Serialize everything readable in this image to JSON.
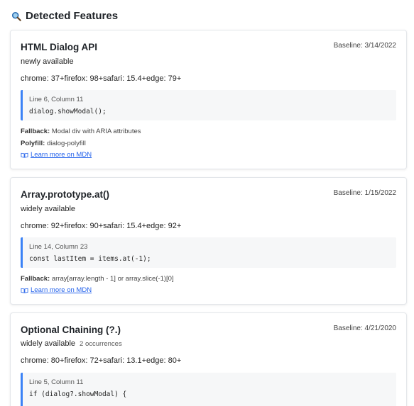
{
  "header": {
    "title": "Detected Features"
  },
  "features": [
    {
      "name": "HTML Dialog API",
      "baseline": "Baseline: 3/14/2022",
      "status": "newly available",
      "occurrences": "",
      "support": "chrome: 37+firefox: 98+safari: 15.4+edge: 79+",
      "location": "Line 6, Column 11",
      "code": "dialog.showModal();",
      "fallback_label": "Fallback:",
      "fallback": "Modal div with ARIA attributes",
      "polyfill_label": "Polyfill:",
      "polyfill": "dialog-polyfill",
      "mdn_label": "Learn more on MDN"
    },
    {
      "name": "Array.prototype.at()",
      "baseline": "Baseline: 1/15/2022",
      "status": "widely available",
      "occurrences": "",
      "support": "chrome: 92+firefox: 90+safari: 15.4+edge: 92+",
      "location": "Line 14, Column 23",
      "code": "const lastItem = items.at(-1);",
      "fallback_label": "Fallback:",
      "fallback": "array[array.length - 1] or array.slice(-1)[0]",
      "mdn_label": "Learn more on MDN"
    },
    {
      "name": "Optional Chaining (?.)",
      "baseline": "Baseline: 4/21/2020",
      "status": "widely available",
      "occurrences": "2 occurrences",
      "support": "chrome: 80+firefox: 72+safari: 13.1+edge: 80+",
      "location": "Line 5, Column 11",
      "code": "if (dialog?.showModal) {"
    }
  ]
}
